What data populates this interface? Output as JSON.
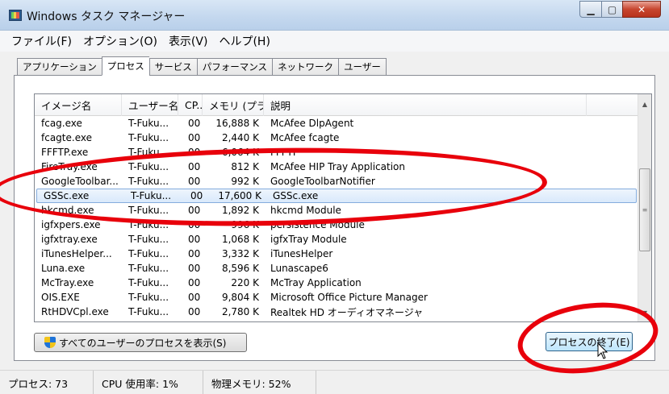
{
  "window": {
    "title": "Windows タスク マネージャー",
    "min_glyph": "▁",
    "max_glyph": "▢",
    "close_glyph": "✕"
  },
  "menu": [
    "ファイル(F)",
    "オプション(O)",
    "表示(V)",
    "ヘルプ(H)"
  ],
  "tabs": [
    {
      "label": "アプリケーション",
      "active": false
    },
    {
      "label": "プロセス",
      "active": true
    },
    {
      "label": "サービス",
      "active": false
    },
    {
      "label": "パフォーマンス",
      "active": false
    },
    {
      "label": "ネットワーク",
      "active": false
    },
    {
      "label": "ユーザー",
      "active": false
    }
  ],
  "columns": {
    "name": "イメージ名",
    "user": "ユーザー名",
    "cpu": "CP...",
    "mem": "メモリ (プラ...",
    "desc": "説明"
  },
  "processes": [
    {
      "name": "fcag.exe",
      "user": "T-Fuku...",
      "cpu": "00",
      "mem": "16,888 K",
      "desc": "McAfee DlpAgent"
    },
    {
      "name": "fcagte.exe",
      "user": "T-Fuku...",
      "cpu": "00",
      "mem": "2,440 K",
      "desc": "McAfee fcagte"
    },
    {
      "name": "FFFTP.exe",
      "user": "T-Fuku...",
      "cpu": "00",
      "mem": "6,064 K",
      "desc": "FFFTP"
    },
    {
      "name": "FireTray.exe",
      "user": "T-Fuku...",
      "cpu": "00",
      "mem": "812 K",
      "desc": "McAfee HIP Tray Application"
    },
    {
      "name": "GoogleToolbar...",
      "user": "T-Fuku...",
      "cpu": "00",
      "mem": "992 K",
      "desc": "GoogleToolbarNotifier"
    },
    {
      "name": "GSSc.exe",
      "user": "T-Fuku...",
      "cpu": "00",
      "mem": "17,600 K",
      "desc": "GSSc.exe",
      "selected": true
    },
    {
      "name": "hkcmd.exe",
      "user": "T-Fuku...",
      "cpu": "00",
      "mem": "1,892 K",
      "desc": "hkcmd Module"
    },
    {
      "name": "igfxpers.exe",
      "user": "T-Fuku...",
      "cpu": "00",
      "mem": "996 K",
      "desc": "persistence Module"
    },
    {
      "name": "igfxtray.exe",
      "user": "T-Fuku...",
      "cpu": "00",
      "mem": "1,068 K",
      "desc": "igfxTray Module"
    },
    {
      "name": "iTunesHelper...",
      "user": "T-Fuku...",
      "cpu": "00",
      "mem": "3,332 K",
      "desc": "iTunesHelper"
    },
    {
      "name": "Luna.exe",
      "user": "T-Fuku...",
      "cpu": "00",
      "mem": "8,596 K",
      "desc": "Lunascape6"
    },
    {
      "name": "McTray.exe",
      "user": "T-Fuku...",
      "cpu": "00",
      "mem": "220 K",
      "desc": "McTray Application"
    },
    {
      "name": "OIS.EXE",
      "user": "T-Fuku...",
      "cpu": "00",
      "mem": "9,804 K",
      "desc": "Microsoft Office Picture Manager"
    },
    {
      "name": "RtHDVCpl.exe",
      "user": "T-Fuku...",
      "cpu": "00",
      "mem": "2,780 K",
      "desc": "Realtek HD オーディオマネージャ"
    }
  ],
  "scroll": {
    "up": "▲",
    "down": "▼",
    "grip": "≡"
  },
  "buttons": {
    "show_all": "すべてのユーザーのプロセスを表示(S)",
    "end_process": "プロセスの終了(E)"
  },
  "status": {
    "processes": "プロセス: 73",
    "cpu": "CPU 使用率: 1%",
    "memory": "物理メモリ: 52%"
  },
  "colors": {
    "annotation": "#e8000b",
    "selection": "#d9e9fb"
  }
}
